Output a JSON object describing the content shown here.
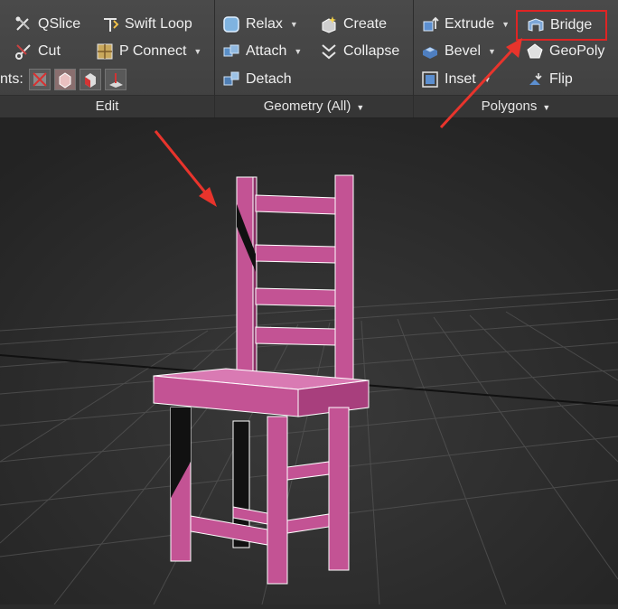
{
  "ribbon": {
    "edit": {
      "title": "Edit",
      "qslice": "QSlice",
      "swift_loop": "Swift Loop",
      "cut": "Cut",
      "p_connect": "P Connect",
      "constraints_label": "nts:"
    },
    "geometry": {
      "title": "Geometry (All)",
      "relax": "Relax",
      "create": "Create",
      "attach": "Attach",
      "collapse": "Collapse",
      "detach": "Detach"
    },
    "polygons": {
      "title": "Polygons",
      "extrude": "Extrude",
      "bridge": "Bridge",
      "bevel": "Bevel",
      "geopoly": "GeoPoly",
      "inset": "Inset",
      "flip": "Flip"
    }
  },
  "colors": {
    "highlight": "#e02424",
    "annotation_arrow": "#e8342c",
    "model_face": "#c35394",
    "model_edge": "#ffffff",
    "viewport_bg": "#2b2b2b",
    "grid": "#555555"
  },
  "icons": {
    "qslice": "qslice-icon",
    "swift_loop": "swift-loop-icon",
    "cut": "cut-icon",
    "p_connect": "p-connect-icon",
    "relax": "relax-icon",
    "create": "create-icon",
    "attach": "attach-icon",
    "collapse": "collapse-icon",
    "detach": "detach-icon",
    "extrude": "extrude-icon",
    "bridge": "bridge-icon",
    "bevel": "bevel-icon",
    "geopoly": "geopoly-icon",
    "inset": "inset-icon",
    "flip": "flip-icon"
  }
}
